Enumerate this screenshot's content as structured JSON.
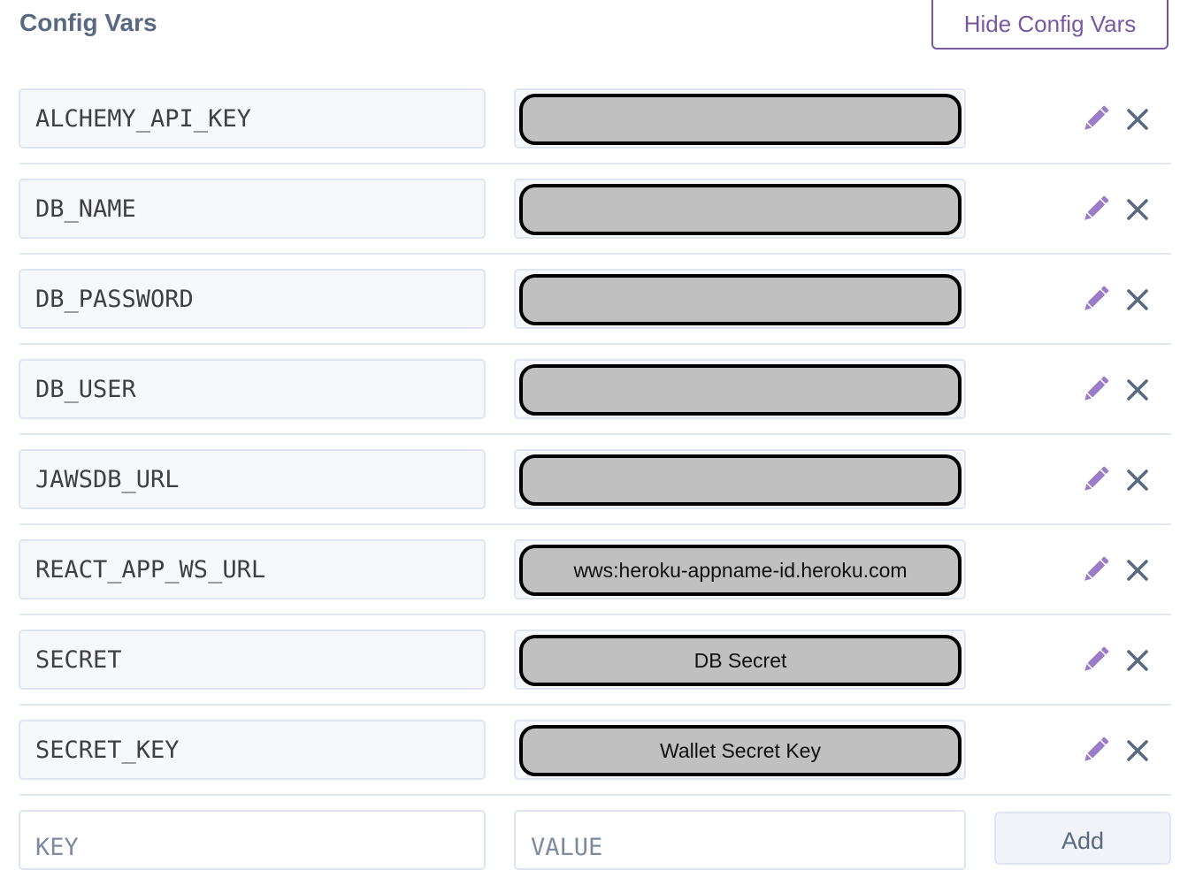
{
  "header": {
    "title": "Config Vars",
    "toggle_button_label": "Hide Config Vars"
  },
  "config_vars": [
    {
      "key": "ALCHEMY_API_KEY",
      "value": ""
    },
    {
      "key": "DB_NAME",
      "value": ""
    },
    {
      "key": "DB_PASSWORD",
      "value": ""
    },
    {
      "key": "DB_USER",
      "value": ""
    },
    {
      "key": "JAWSDB_URL",
      "value": ""
    },
    {
      "key": "REACT_APP_WS_URL",
      "value": "wws:heroku-appname-id.heroku.com"
    },
    {
      "key": "SECRET",
      "value": "DB Secret"
    },
    {
      "key": "SECRET_KEY",
      "value": "Wallet Secret Key"
    }
  ],
  "new_var": {
    "key_placeholder": "KEY",
    "value_placeholder": "VALUE",
    "add_label": "Add"
  },
  "icons": {
    "edit": "pencil-icon",
    "delete": "close-icon"
  },
  "colors": {
    "accent": "#79589f",
    "title": "#596981",
    "icon_grey": "#596981",
    "redaction_fill": "#c0c0c0"
  }
}
